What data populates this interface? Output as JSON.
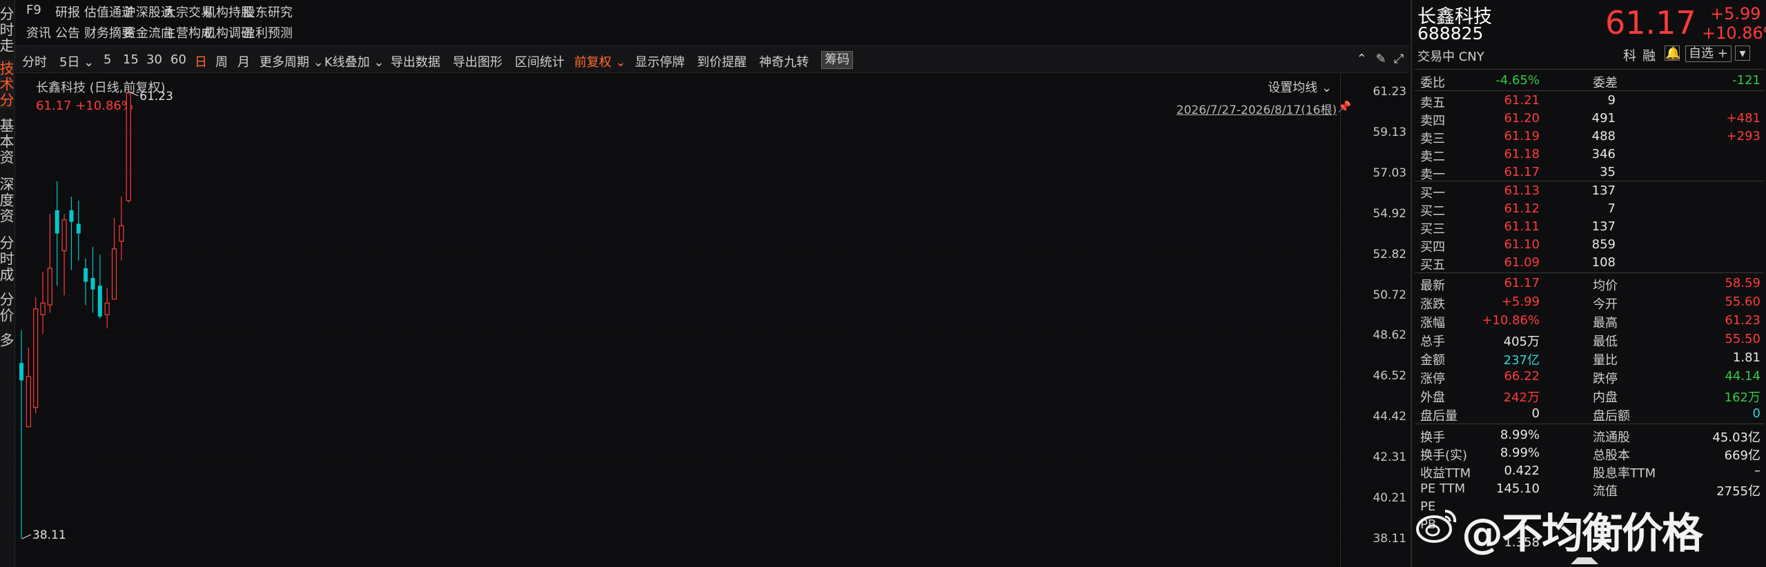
{
  "leftnav": [
    {
      "label": "分时走势",
      "active": false
    },
    {
      "label": "技术分析",
      "active": true
    },
    {
      "label": "基本资料",
      "active": false
    },
    {
      "label": "深度资料",
      "active": false
    },
    {
      "label": "分时成交",
      "active": false
    },
    {
      "label": "分价表",
      "active": false
    },
    {
      "label": "多",
      "active": false
    }
  ],
  "topmenu": {
    "row1": [
      "F9",
      "研报",
      "估值通道",
      "沪深股通",
      "大宗交易",
      "机构持股",
      "股东研究"
    ],
    "row2": [
      "资讯",
      "公告",
      "财务摘要",
      "资金流向",
      "主营构成",
      "机构调研",
      "盈利预测"
    ]
  },
  "toolbar": {
    "items": [
      "分时",
      "5日",
      "5",
      "15",
      "30",
      "60",
      "日",
      "周",
      "月",
      "更多周期",
      "K线叠加",
      "导出数据",
      "导出图形",
      "区间统计",
      "前复权",
      "显示停牌",
      "到价提醒",
      "神奇九转",
      "筹码"
    ],
    "active": "日"
  },
  "chart": {
    "title": "长鑫科技 (日线,前复权)",
    "price_line": "61.17 +10.86%",
    "setting": "设置均线",
    "range": "2026/7/27-2026/8/17(16根)",
    "high_label": "61.23",
    "low_label": "38.11",
    "yticks": [
      "61.23",
      "59.13",
      "57.03",
      "54.92",
      "52.82",
      "50.72",
      "48.62",
      "46.52",
      "44.42",
      "42.31",
      "40.21",
      "38.11"
    ]
  },
  "chart_data": {
    "type": "candlestick",
    "ylim": [
      38.11,
      61.23
    ],
    "candles": [
      {
        "o": 46.3,
        "c": 47.2,
        "h": 48.9,
        "l": 38.11,
        "up": false
      },
      {
        "o": 43.9,
        "c": 46.5,
        "h": 48.0,
        "l": 43.9,
        "up": true
      },
      {
        "o": 44.9,
        "c": 50.0,
        "h": 50.6,
        "l": 44.6,
        "up": true
      },
      {
        "o": 49.7,
        "c": 50.3,
        "h": 51.9,
        "l": 48.7,
        "up": true
      },
      {
        "o": 50.2,
        "c": 52.1,
        "h": 54.9,
        "l": 49.8,
        "up": true
      },
      {
        "o": 55.1,
        "c": 53.9,
        "h": 56.6,
        "l": 51.2,
        "up": false
      },
      {
        "o": 53.0,
        "c": 54.6,
        "h": 54.9,
        "l": 50.7,
        "up": true
      },
      {
        "o": 54.5,
        "c": 55.1,
        "h": 55.8,
        "l": 52.0,
        "up": false
      },
      {
        "o": 54.4,
        "c": 53.9,
        "h": 55.6,
        "l": 52.5,
        "up": false
      },
      {
        "o": 52.1,
        "c": 51.4,
        "h": 52.6,
        "l": 50.2,
        "up": false
      },
      {
        "o": 51.6,
        "c": 51.0,
        "h": 53.2,
        "l": 49.8,
        "up": false
      },
      {
        "o": 51.2,
        "c": 49.6,
        "h": 52.8,
        "l": 49.5,
        "up": false
      },
      {
        "o": 49.7,
        "c": 50.3,
        "h": 51.1,
        "l": 49.0,
        "up": true
      },
      {
        "o": 50.5,
        "c": 53.1,
        "h": 54.7,
        "l": 50.5,
        "up": true
      },
      {
        "o": 53.5,
        "c": 54.3,
        "h": 55.8,
        "l": 52.5,
        "up": true
      },
      {
        "o": 55.6,
        "c": 61.17,
        "h": 61.23,
        "l": 55.5,
        "up": true
      }
    ]
  },
  "quote": {
    "name": "长鑫科技",
    "code": "688825",
    "status": "交易中 CNY",
    "price": "61.17",
    "change": "+5.99",
    "pct": "+10.86%",
    "tags": [
      "科",
      "融"
    ],
    "watch": "自选 +"
  },
  "book": {
    "ratio_label": "委比",
    "ratio": "-4.65%",
    "diff_label": "委差",
    "diff": "-121",
    "asks": [
      {
        "label": "卖五",
        "price": "61.21",
        "vol": "9",
        "chg": ""
      },
      {
        "label": "卖四",
        "price": "61.20",
        "vol": "491",
        "chg": "+481"
      },
      {
        "label": "卖三",
        "price": "61.19",
        "vol": "488",
        "chg": "+293"
      },
      {
        "label": "卖二",
        "price": "61.18",
        "vol": "346",
        "chg": ""
      },
      {
        "label": "卖一",
        "price": "61.17",
        "vol": "35",
        "chg": ""
      }
    ],
    "bids": [
      {
        "label": "买一",
        "price": "61.13",
        "vol": "137",
        "chg": ""
      },
      {
        "label": "买二",
        "price": "61.12",
        "vol": "7",
        "chg": ""
      },
      {
        "label": "买三",
        "price": "61.11",
        "vol": "137",
        "chg": ""
      },
      {
        "label": "买四",
        "price": "61.10",
        "vol": "859",
        "chg": ""
      },
      {
        "label": "买五",
        "price": "61.09",
        "vol": "108",
        "chg": ""
      }
    ]
  },
  "stats": [
    {
      "l1": "最新",
      "v1": "61.17",
      "c1": "red",
      "l2": "均价",
      "v2": "58.59",
      "c2": "red"
    },
    {
      "l1": "涨跌",
      "v1": "+5.99",
      "c1": "red",
      "l2": "今开",
      "v2": "55.60",
      "c2": "red"
    },
    {
      "l1": "涨幅",
      "v1": "+10.86%",
      "c1": "red",
      "l2": "最高",
      "v2": "61.23",
      "c2": "red"
    },
    {
      "l1": "总手",
      "v1": "405万",
      "c1": "white",
      "l2": "最低",
      "v2": "55.50",
      "c2": "red"
    },
    {
      "l1": "金额",
      "v1": "237亿",
      "c1": "cyan",
      "l2": "量比",
      "v2": "1.81",
      "c2": "white"
    },
    {
      "l1": "涨停",
      "v1": "66.22",
      "c1": "red",
      "l2": "跌停",
      "v2": "44.14",
      "c2": "green"
    },
    {
      "l1": "外盘",
      "v1": "242万",
      "c1": "red",
      "l2": "内盘",
      "v2": "162万",
      "c2": "green"
    },
    {
      "l1": "盘后量",
      "v1": "0",
      "c1": "white",
      "l2": "盘后额",
      "v2": "0",
      "c2": "cyan"
    }
  ],
  "fund": [
    {
      "l1": "换手",
      "v1": "8.99%",
      "l2": "流通股",
      "v2": "45.03亿"
    },
    {
      "l1": "换手(实)",
      "v1": "8.99%",
      "l2": "总股本",
      "v2": "669亿"
    },
    {
      "l1": "收益TTM",
      "v1": "0.422",
      "l2": "股息率TTM",
      "v2": "–"
    },
    {
      "l1": "PE TTM",
      "v1": "145.10",
      "l2": "流值",
      "v2": "2755亿"
    },
    {
      "l1": "PE",
      "v1": "",
      "l2": "",
      "v2": ""
    },
    {
      "l1": "PB",
      "v1": "",
      "l2": "",
      "v2": ""
    },
    {
      "l1": "",
      "v1": "1.358",
      "l2": "",
      "v2": ""
    }
  ],
  "watermark": "@不均衡价格",
  "colors": {
    "up": "#ff3b3b",
    "down": "#00c8c8",
    "accent": "#ff6a2a"
  }
}
